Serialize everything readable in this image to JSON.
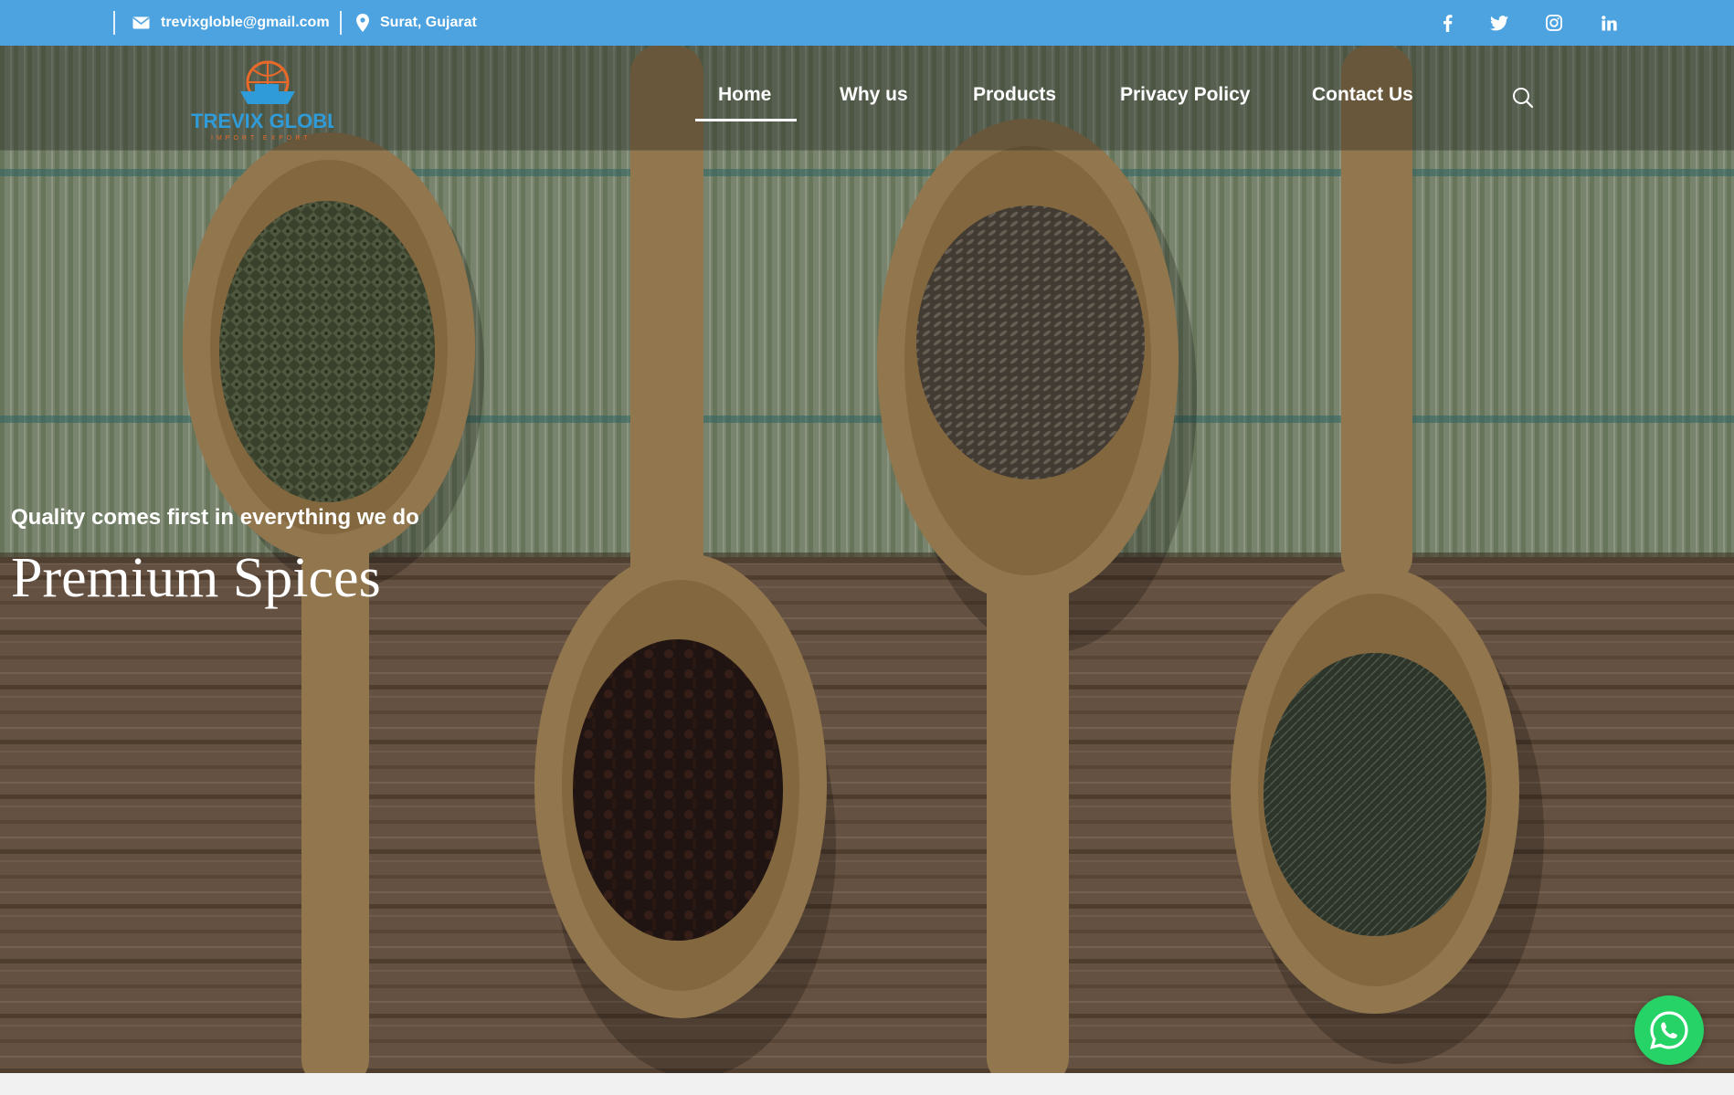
{
  "topbar": {
    "email": "trevixgloble@gmail.com",
    "location": "Surat, Gujarat",
    "background": "#4da3e0",
    "icons": {
      "email": "envelope-icon",
      "location": "map-pin-icon",
      "social": [
        "facebook-icon",
        "twitter-icon",
        "instagram-icon",
        "linkedin-icon"
      ]
    }
  },
  "brand": {
    "name": "TREVIX GLOBLE",
    "tagline": "IMPORT EXPORT",
    "colors": {
      "primary": "#2f9bd8",
      "accent": "#e8692a"
    }
  },
  "nav": {
    "items": [
      "Home",
      "Why us",
      "Products",
      "Privacy Policy",
      "Contact Us"
    ],
    "active": "Home",
    "search_icon": "search-icon"
  },
  "hero": {
    "tagline": "Quality comes first in everything we do",
    "headline": "Premium Spices"
  },
  "whatsapp": {
    "icon": "whatsapp-icon",
    "color": "#25d366"
  }
}
